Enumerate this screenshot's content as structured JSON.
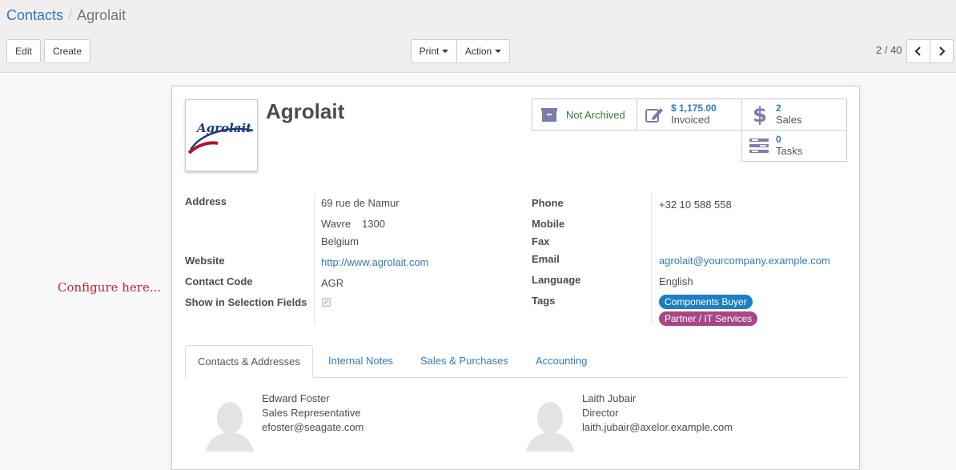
{
  "breadcrumb": {
    "parent": "Contacts",
    "separator": "/",
    "current": "Agrolait"
  },
  "toolbar": {
    "edit": "Edit",
    "create": "Create",
    "print": "Print",
    "action": "Action"
  },
  "pager": {
    "value": "2 / 40"
  },
  "partner": {
    "name": "Agrolait",
    "logo_text": "Agrolait"
  },
  "stats": {
    "archive_label": "Not Archived",
    "invoiced_amount": "$ 1,175.00",
    "invoiced_label": "Invoiced",
    "sales_count": "2",
    "sales_label": "Sales",
    "tasks_count": "0",
    "tasks_label": "Tasks"
  },
  "fields": {
    "address_label": "Address",
    "street": "69 rue de Namur",
    "city": "Wavre",
    "zip": "1300",
    "country": "Belgium",
    "website_label": "Website",
    "website": "http://www.agrolait.com",
    "contact_code_label": "Contact Code",
    "contact_code": "AGR",
    "show_in_selection_label": "Show in Selection Fields",
    "show_in_selection": true,
    "phone_label": "Phone",
    "phone": "+32 10 588 558",
    "mobile_label": "Mobile",
    "fax_label": "Fax",
    "email_label": "Email",
    "email": "agrolait@yourcompany.example.com",
    "language_label": "Language",
    "language": "English",
    "tags_label": "Tags"
  },
  "tags": [
    {
      "label": "Components Buyer",
      "color": "#1e7fc2"
    },
    {
      "label": "Partner / IT Services",
      "color": "#a94687"
    }
  ],
  "tabs": [
    "Contacts & Addresses",
    "Internal Notes",
    "Sales & Purchases",
    "Accounting"
  ],
  "contacts": [
    {
      "name": "Edward Foster",
      "role": "Sales Representative",
      "email": "efoster@seagate.com"
    },
    {
      "name": "Laith Jubair",
      "role": "Director",
      "email": "laith.jubair@axelor.example.com"
    }
  ],
  "annotation": "Configure here..."
}
